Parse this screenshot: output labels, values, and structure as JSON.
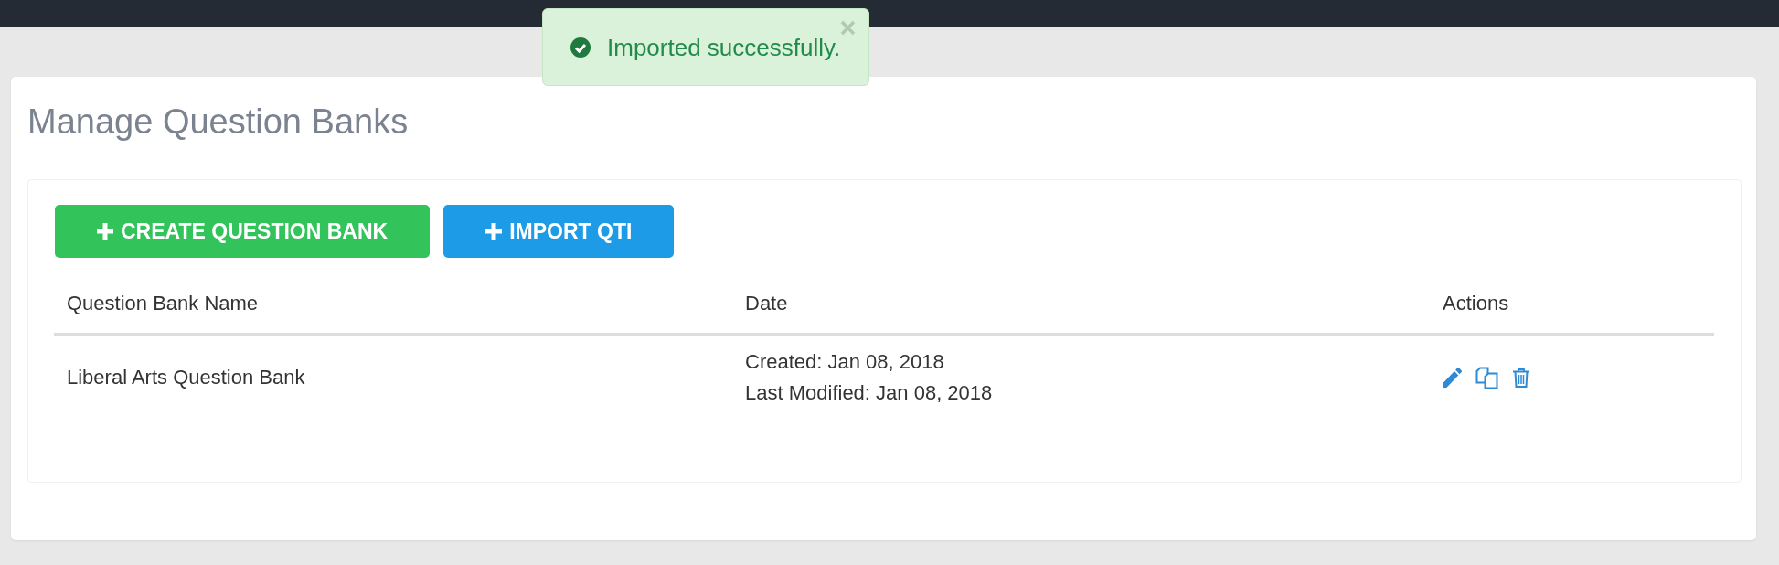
{
  "toast": {
    "kind": "success",
    "message": "Imported successfully.",
    "dismissible": true
  },
  "page": {
    "title": "Manage Question Banks"
  },
  "toolbar": {
    "buttons": [
      {
        "kind": "success",
        "label": "CREATE QUESTION BANK"
      },
      {
        "kind": "primary",
        "label": "IMPORT QTI"
      }
    ]
  },
  "table": {
    "columns": [
      "Question Bank Name",
      "Date",
      "Actions"
    ],
    "rows": [
      {
        "name": "Liberal Arts Question Bank",
        "created": "Created: Jan 08, 2018",
        "last_modified": "Last Modified: Jan 08, 2018"
      }
    ]
  }
}
